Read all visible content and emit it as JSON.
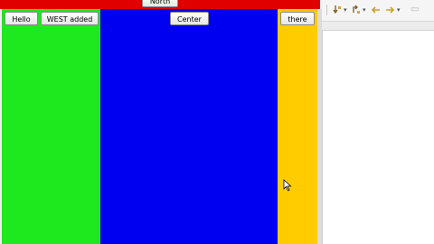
{
  "layout_demo": {
    "north_button": "North",
    "west_buttons": [
      "Hello",
      "WEST added"
    ],
    "center_button": "Center",
    "east_button": "there"
  },
  "colors": {
    "north": "#e00000",
    "west": "#1ee81e",
    "center": "#0000f0",
    "east": "#ffcc00"
  },
  "ide_toolbar": {
    "icons": [
      "separator-icon",
      "step-into-icon",
      "dropdown-arrow-icon",
      "step-over-icon",
      "dropdown-arrow-icon",
      "back-icon",
      "forward-icon",
      "dropdown-arrow-icon",
      "minimize-icon"
    ]
  }
}
